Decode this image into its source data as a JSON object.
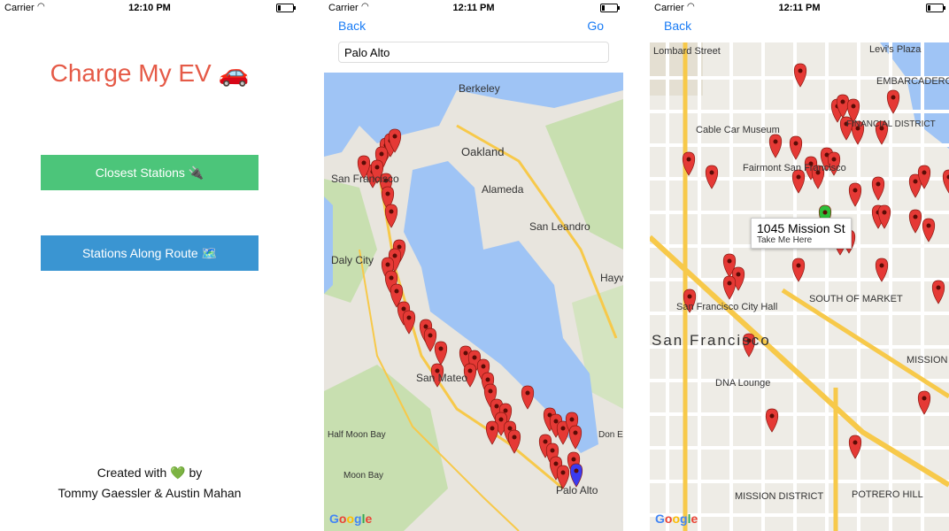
{
  "status": {
    "carrier": "Carrier",
    "times": [
      "12:10 PM",
      "12:11 PM",
      "12:11 PM"
    ]
  },
  "screen1": {
    "title": "Charge My EV 🚗",
    "closest_label": "Closest Stations 🔌",
    "route_label": "Stations Along Route 🗺️",
    "credits_line1": "Created with 💚 by",
    "credits_line2": "Tommy Gaessler & Austin Mahan"
  },
  "screen2": {
    "back": "Back",
    "go": "Go",
    "search_value": "Palo Alto",
    "map_labels": [
      "Berkeley",
      "Oakland",
      "San Francisco",
      "Alameda",
      "San Leandro",
      "Daly City",
      "Hayward",
      "San Mateo",
      "Palo Alto",
      "Half Moon Bay",
      "Moon Bay",
      "Don Edwards"
    ]
  },
  "screen3": {
    "back": "Back",
    "callout_title": "1045 Mission St",
    "callout_sub": "Take Me Here",
    "map_labels": [
      "Lombard Street",
      "Levi's Plaza",
      "EMBARCADERO",
      "Cable Car Museum",
      "Fairmont San Francisco",
      "FINANCIAL DISTRICT",
      "San Francisco City Hall",
      "SOUTH OF MARKET",
      "San Francisco",
      "DNA Lounge",
      "MISSION DISTRICT",
      "POTRERO HILL",
      "MISSION"
    ]
  },
  "branding": {
    "google": "Google"
  },
  "colors": {
    "title": "#e55a47",
    "green_button": "#4cc57a",
    "blue_button": "#3a95d2",
    "link": "#1a7cf5",
    "marker": "#e53935",
    "water": "#9fc4f5",
    "land": "#e8e5de"
  }
}
